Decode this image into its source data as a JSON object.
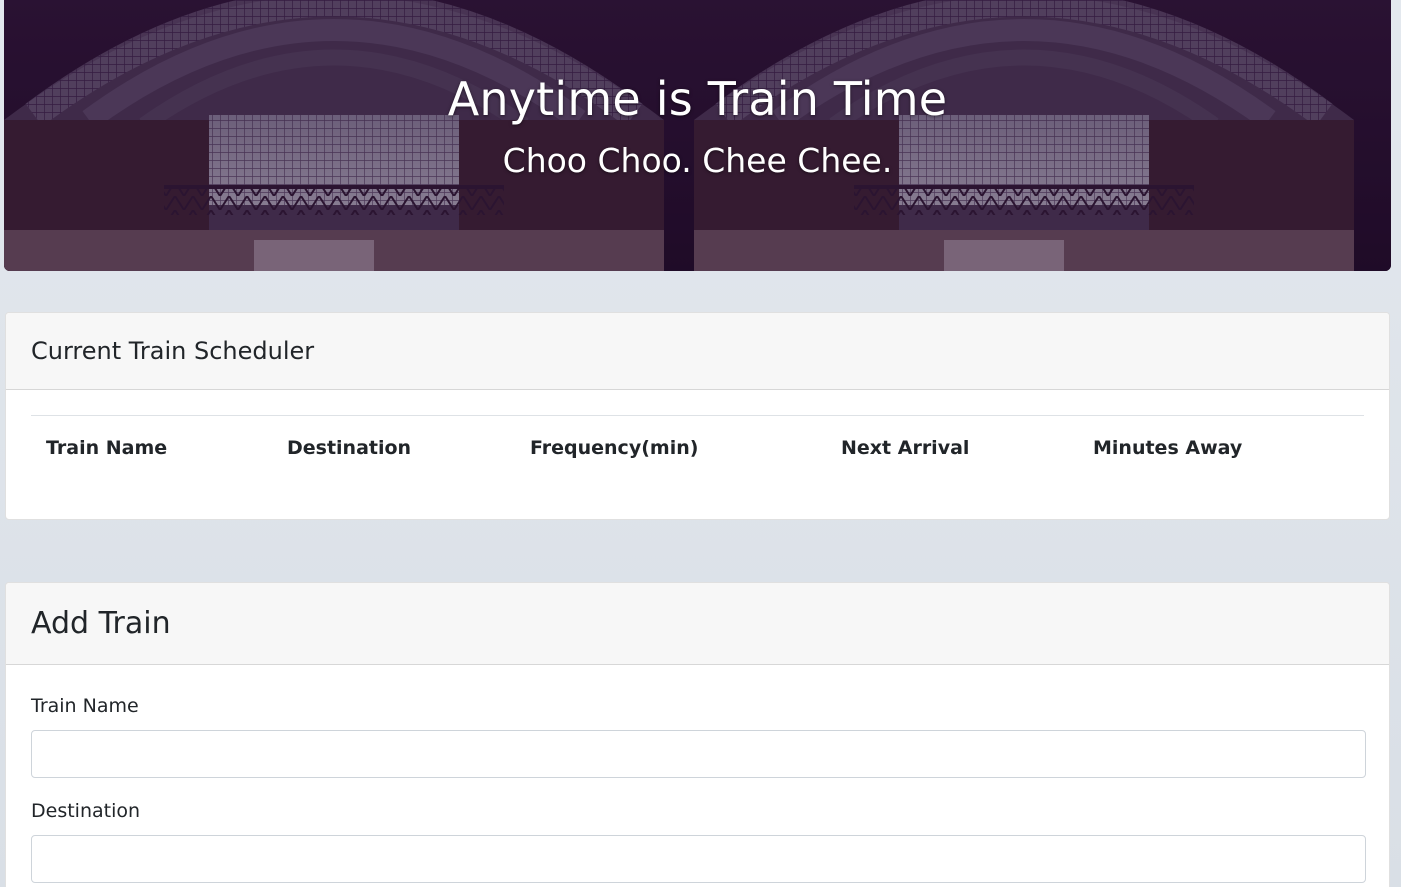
{
  "hero": {
    "title": "Anytime is Train Time",
    "subtitle": "Choo Choo. Chee Chee."
  },
  "schedule": {
    "heading": "Current Train Scheduler",
    "columns": [
      "Train Name",
      "Destination",
      "Frequency(min)",
      "Next Arrival",
      "Minutes Away"
    ],
    "rows": []
  },
  "add_train": {
    "heading": "Add Train",
    "fields": [
      {
        "label": "Train Name",
        "value": "",
        "placeholder": ""
      },
      {
        "label": "Destination",
        "value": "",
        "placeholder": ""
      }
    ]
  },
  "colors": {
    "hero_overlay": "#1d0b26",
    "card_header_bg": "#f7f7f7",
    "page_bg": "#dde3ea"
  }
}
